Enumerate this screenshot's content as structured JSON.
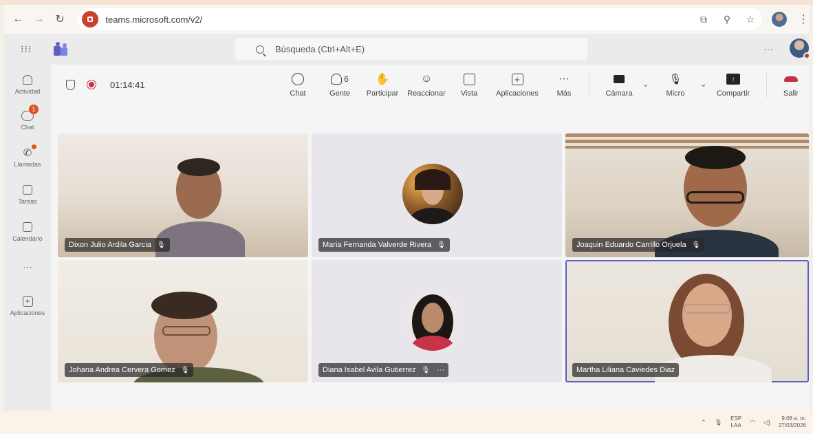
{
  "browser": {
    "url": "teams.microsoft.com/v2/"
  },
  "header": {
    "search_placeholder": "Búsqueda (Ctrl+Alt+E)",
    "more": "···"
  },
  "rail": {
    "items": [
      {
        "label": "Actividad",
        "icon": "bell-icon"
      },
      {
        "label": "Chat",
        "icon": "chat-icon",
        "badge": "1"
      },
      {
        "label": "Llamadas",
        "icon": "phone-icon"
      },
      {
        "label": "Tareas",
        "icon": "tasks-icon"
      },
      {
        "label": "Calendario",
        "icon": "calendar-icon"
      },
      {
        "label": "···",
        "icon": "more-icon"
      },
      {
        "label": "Aplicaciones",
        "icon": "apps-icon"
      }
    ]
  },
  "meeting": {
    "timer": "01:14:41",
    "people_count": "6",
    "toolbar": [
      {
        "label": "Chat",
        "icon": "chat-icon"
      },
      {
        "label": "Gente",
        "icon": "people-icon"
      },
      {
        "label": "Participar",
        "icon": "raise-hand-icon"
      },
      {
        "label": "Reaccionar",
        "icon": "emoji-icon"
      },
      {
        "label": "Vista",
        "icon": "grid-view-icon"
      },
      {
        "label": "Aplicaciones",
        "icon": "apps-icon"
      },
      {
        "label": "Más",
        "icon": "more-icon"
      },
      {
        "label": "Cámara",
        "icon": "camera-icon"
      },
      {
        "label": "Micro",
        "icon": "mic-muted-icon"
      },
      {
        "label": "Compartir",
        "icon": "share-icon"
      },
      {
        "label": "Salir",
        "icon": "leave-icon"
      }
    ],
    "participants": [
      {
        "name": "Dixon Julio Ardila Garcia",
        "muted": true
      },
      {
        "name": "Maria Fernanda Valverde Rivera",
        "muted": true
      },
      {
        "name": "Joaquin Eduardo Carrillo Orjuela",
        "muted": true
      },
      {
        "name": "Johana Andrea Cervera Gomez",
        "muted": true
      },
      {
        "name": "Diana Isabel Avila Gutierrez",
        "muted": true
      },
      {
        "name": "Martha Liliana Caviedes Diaz",
        "muted": false
      }
    ]
  },
  "taskbar": {
    "lang_top": "ESP",
    "lang_bottom": "LAA",
    "time": "9:08 a. m.",
    "date": "27/03/2026"
  },
  "colors": {
    "accent": "#5b5fc7",
    "leave": "#c4314b",
    "badge": "#e0531e"
  }
}
